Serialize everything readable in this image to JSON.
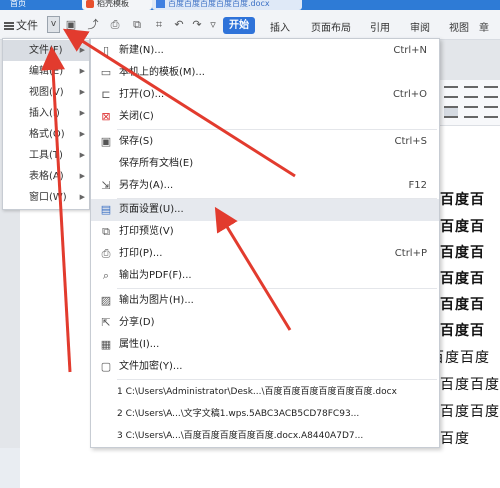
{
  "title_tabs": {
    "home": "首页",
    "doc1": "稻壳模板",
    "doc2": "百度百度百度百度百度.docx"
  },
  "toolbar": {
    "file_menu": "文件",
    "dropdown_icon": "v",
    "start": "开始",
    "tabs": [
      "插入",
      "页面布局",
      "引用",
      "审阅",
      "视图"
    ],
    "more": "章"
  },
  "left_menu": {
    "items": [
      {
        "label": "文件(F)",
        "selected": true
      },
      {
        "label": "编辑(E)",
        "selected": false
      },
      {
        "label": "视图(V)",
        "selected": false
      },
      {
        "label": "插入(I)",
        "selected": false
      },
      {
        "label": "格式(O)",
        "selected": false
      },
      {
        "label": "工具(T)",
        "selected": false
      },
      {
        "label": "表格(A)",
        "selected": false
      },
      {
        "label": "窗口(W)",
        "selected": false
      }
    ]
  },
  "file_menu": {
    "items": [
      {
        "label": "新建(N)...",
        "shortcut": "Ctrl+N",
        "icon": "new-file-icon"
      },
      {
        "label": "本机上的模板(M)...",
        "shortcut": "",
        "icon": "template-icon"
      },
      {
        "label": "打开(O)...",
        "shortcut": "Ctrl+O",
        "icon": "open-folder-icon"
      },
      {
        "label": "关闭(C)",
        "shortcut": "",
        "icon": "close-doc-icon"
      },
      {
        "label": "保存(S)",
        "shortcut": "Ctrl+S",
        "icon": "save-icon"
      },
      {
        "label": "保存所有文档(E)",
        "shortcut": "",
        "icon": ""
      },
      {
        "label": "另存为(A)...",
        "shortcut": "F12",
        "icon": "save-as-icon"
      },
      {
        "label": "页面设置(U)...",
        "shortcut": "",
        "icon": "page-setup-icon"
      },
      {
        "label": "打印预览(V)",
        "shortcut": "",
        "icon": "print-preview-icon"
      },
      {
        "label": "打印(P)...",
        "shortcut": "Ctrl+P",
        "icon": "print-icon"
      },
      {
        "label": "输出为PDF(F)...",
        "shortcut": "",
        "icon": "pdf-icon"
      },
      {
        "label": "输出为图片(H)...",
        "shortcut": "",
        "icon": "image-export-icon"
      },
      {
        "label": "分享(D)",
        "shortcut": "",
        "icon": "share-icon"
      },
      {
        "label": "属性(I)...",
        "shortcut": "",
        "icon": "properties-icon"
      },
      {
        "label": "文件加密(Y)...",
        "shortcut": "",
        "icon": "encrypt-icon"
      }
    ],
    "recent": [
      "1 C:\\Users\\Administrator\\Desk...\\百度百度百度百度百度百度.docx",
      "2 C:\\Users\\A...\\文字文稿1.wps.5ABC3ACB5CD78FC93...",
      "3 C:\\Users\\A...\\百度百度百度百度百度.docx.A8440A7D7..."
    ]
  },
  "document": {
    "lines": [
      "百度百",
      "百度百",
      "百度百",
      "百度百",
      "百度百",
      "百度百",
      "百度百度",
      "百度百度",
      "百度百度",
      "百度"
    ]
  }
}
